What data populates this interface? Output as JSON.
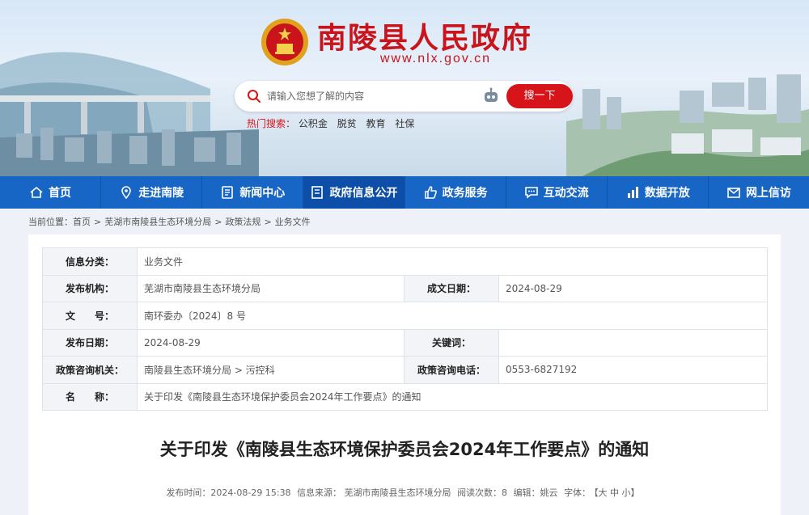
{
  "header": {
    "site_title": "南陵县人民政府",
    "site_url": "www.nlx.gov.cn",
    "search_placeholder": "请输入您想了解的内容",
    "search_button": "搜一下",
    "hot_label": "热门搜索：",
    "hot_items": [
      "公积金",
      "脱贫",
      "教育",
      "社保"
    ]
  },
  "nav": [
    {
      "label": "首页",
      "icon": "home-icon"
    },
    {
      "label": "走进南陵",
      "icon": "location-icon"
    },
    {
      "label": "新闻中心",
      "icon": "news-icon"
    },
    {
      "label": "政府信息公开",
      "icon": "document-icon"
    },
    {
      "label": "政务服务",
      "icon": "thumbs-up-icon"
    },
    {
      "label": "互动交流",
      "icon": "chat-icon"
    },
    {
      "label": "数据开放",
      "icon": "chart-icon"
    },
    {
      "label": "网上信访",
      "icon": "mail-icon"
    }
  ],
  "breadcrumb": {
    "prefix": "当前位置：",
    "items": [
      "首页",
      "芜湖市南陵县生态环境分局",
      "政策法规",
      "业务文件"
    ],
    "separator": ">"
  },
  "info": {
    "category_label": "信息分类：",
    "category": "业务文件",
    "publisher_label": "发布机构：",
    "publisher": "芜湖市南陵县生态环境分局",
    "created_label": "成文日期：",
    "created": "2024-08-29",
    "doc_no_label": "文　　号：",
    "doc_no": "南环委办〔2024〕8 号",
    "pub_date_label": "发布日期：",
    "pub_date": "2024-08-29",
    "keywords_label": "关键词：",
    "keywords": "",
    "consult_org_label": "政策咨询机关：",
    "consult_org": "南陵县生态环境分局 > 污控科",
    "consult_phone_label": "政策咨询电话：",
    "consult_phone": "0553-6827192",
    "name_label": "名　　称：",
    "name": "关于印发《南陵县生态环境保护委员会2024年工作要点》的通知"
  },
  "article": {
    "title": "关于印发《南陵县生态环境保护委员会2024年工作要点》的通知",
    "meta_time": "发布时间：2024-08-29 15:38",
    "meta_source": "信息来源：  芜湖市南陵县生态环境分局",
    "meta_reads": "阅读次数：8",
    "meta_editor": "编辑：姚云",
    "meta_font_label": "字体：",
    "meta_font_ctrl": "【大 中 小】"
  },
  "colors": {
    "brand_red": "#c8141a",
    "nav_blue": "#1766c6"
  }
}
